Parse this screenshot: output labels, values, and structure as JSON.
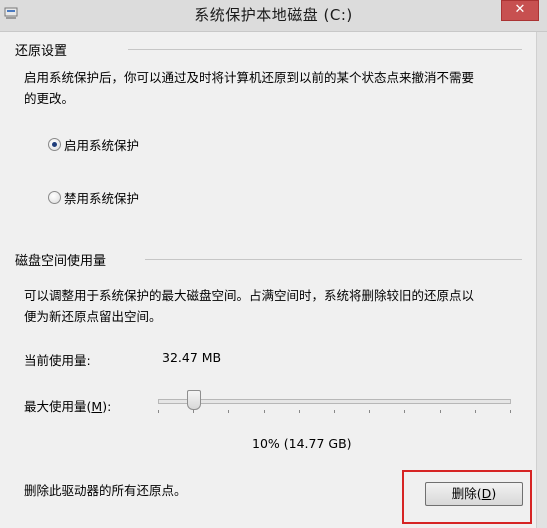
{
  "window": {
    "title": "系统保护本地磁盘 (C:)",
    "close_glyph": "✕"
  },
  "restore": {
    "heading": "还原设置",
    "desc_line1": "启用系统保护后，你可以通过及时将计算机还原到以前的某个状态点来撤消不需要",
    "desc_line2": "的更改。",
    "options": [
      {
        "label": "启用系统保护",
        "selected": true
      },
      {
        "label": "禁用系统保护",
        "selected": false
      }
    ]
  },
  "disk": {
    "heading": "磁盘空间使用量",
    "desc_line1": "可以调整用于系统保护的最大磁盘空间。占满空间时，系统将删除较旧的还原点以",
    "desc_line2": "便为新还原点留出空间。",
    "current_label": "当前使用量:",
    "current_value": "32.47 MB",
    "max_label_prefix": "最大使用量(",
    "max_label_key": "M",
    "max_label_suffix": "):",
    "max_fraction": 0.1,
    "max_value_text": "10% (14.77 GB)",
    "delete_desc": "删除此驱动器的所有还原点。",
    "delete_button_prefix": "删除(",
    "delete_button_key": "D",
    "delete_button_suffix": ")"
  },
  "icons": {
    "system_icon": "system-protection-icon",
    "close": "close-icon",
    "radio": "radio-button"
  },
  "colors": {
    "highlight": "#d62424",
    "close_button": "#c75050",
    "radio_dot": "#1f3d7a"
  }
}
